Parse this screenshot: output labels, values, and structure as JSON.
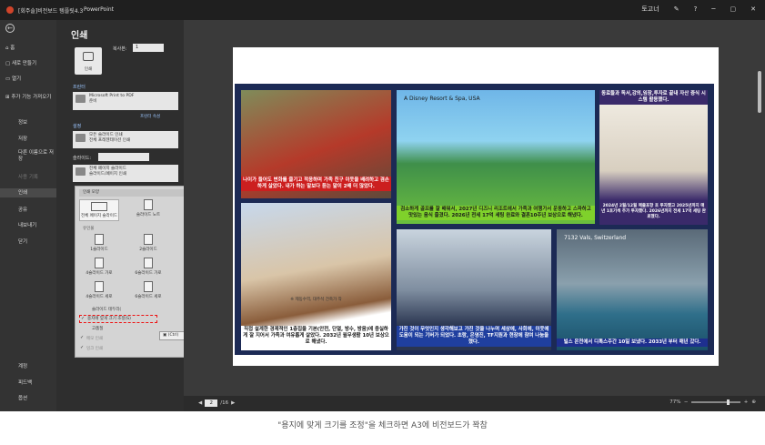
{
  "titlebar": {
    "app_file": "[회주솔]비전보드 템플릿4.3",
    "app_name": "PowerPoint",
    "user": "토고너",
    "help": "?",
    "minimize": "─",
    "restore": "▢",
    "close": "✕"
  },
  "nav": {
    "back_icon": "←",
    "home": "홈",
    "new": "새로 만들기",
    "open": "열기",
    "addins": "추가 기능 가져오기",
    "info": "정보",
    "save": "저장",
    "save_as": "다른 이름으로 저장",
    "history": "사용 기록",
    "print": "인쇄",
    "share": "공유",
    "export": "내보내기",
    "close": "닫기",
    "account": "계정",
    "feedback": "피드백",
    "options": "옵션"
  },
  "print_panel": {
    "title": "인쇄",
    "print_button": "인쇄",
    "copies_label": "복사본:",
    "copies_value": "1",
    "printer_section": "프린터",
    "printer_name": "Microsoft Print to PDF",
    "printer_status": "준비",
    "printer_props": "프린터 속성",
    "settings_section": "설정",
    "range_main": "모든 슬라이드 인쇄",
    "range_sub": "전체 프레젠테이션 인쇄",
    "slides_label": "슬라이드:",
    "layout_main": "전체 페이지 슬라이드",
    "layout_sub": "슬라이드/페이지 인쇄"
  },
  "layout_popup": {
    "title": "인쇄 모양",
    "options": [
      "전체 페이지 슬라이드",
      "슬라이드 노트",
      "개요"
    ],
    "handouts_title": "유인물",
    "handouts": [
      "1슬라이드",
      "2슬라이드",
      "3슬라이드",
      "4슬라이드 가로",
      "6슬라이드 가로",
      "9슬라이드 가로",
      "4슬라이드 세로",
      "6슬라이드 세로",
      "9슬라이드 세로"
    ],
    "frame_slides": "슬라이드 테두리(",
    "scale_to_fit": "용지에 맞게 크기 조정(S)",
    "high_quality": "고품질",
    "print_comments": "메모 인쇄",
    "print_ink": "잉크 인쇄",
    "ctrl_badge": "(Ctrl)"
  },
  "vision_board": {
    "tiles": [
      {
        "caption": "나이가 들어도 변화를 즐기고 적응하며 가족 친구 이웃을 배려하고 겸손하게 살았다. 내가 하는 말보다 듣는 말이 2배 더 많았다."
      },
      {
        "tag": "A Disney Resort & Spa, USA",
        "caption": "검소하게 골프를 잘 배워서, 2027년 디즈니 리조트에서 가족과 여행가서 운동하고 스파하고 맛있는 음식 즐겼다. 2026년 전세 17억 세팅 완료와 결혼10주년 보상으로 해냈다."
      },
      {
        "header": "동료들과 독서,강의,임장,투자로 끝내 자산 증식 시스템 활용했다.",
        "caption": "2024년 2월/12월 매출포항 호 투자했고 2025년까지 매년 1호기씩 추가 투자했다. 2026년까지 전세 17억 세팅 완료했다."
      },
      {
        "overlay": "※ 제동수역, 대주석 건축가 작",
        "caption": "직접 설계한 경제적인 1층집을 기본(안전, 단열, 방수, 방음)에 충실하게 잘 지어서 가족과 여유롭게 살았다. 2032년 월무생활 10년 보상으로 해냈다."
      },
      {
        "caption": "가진 것이 무엇인지 생각해보고 가진 것을 나누며 세상에, 사회에, 이웃에 도움이 되는 기버가 되었다. 초랑, 은영진, TF지원과 현장에 참여 나눔을 했다."
      },
      {
        "tag": "7132 Vals, Switzerland",
        "caption": "빌스 온천에서 디톡스주간 10일 보냈다. 2033년 부터 매년 갔다."
      }
    ]
  },
  "statusbar": {
    "page_current": "2",
    "page_total": "/16",
    "zoom": "77%",
    "zoom_fraction": 0.77
  },
  "caption": "\"용지에 맞게 크기를 조정\"을 체크하면 A3에 비전보드가 꽉참",
  "colors": {
    "board_bg": "#1c2a55",
    "red_caption": "#cc1f1f",
    "green_caption": "#7fd12b",
    "purple_header": "#3a2a6a",
    "highlight": "#e11d1d"
  }
}
